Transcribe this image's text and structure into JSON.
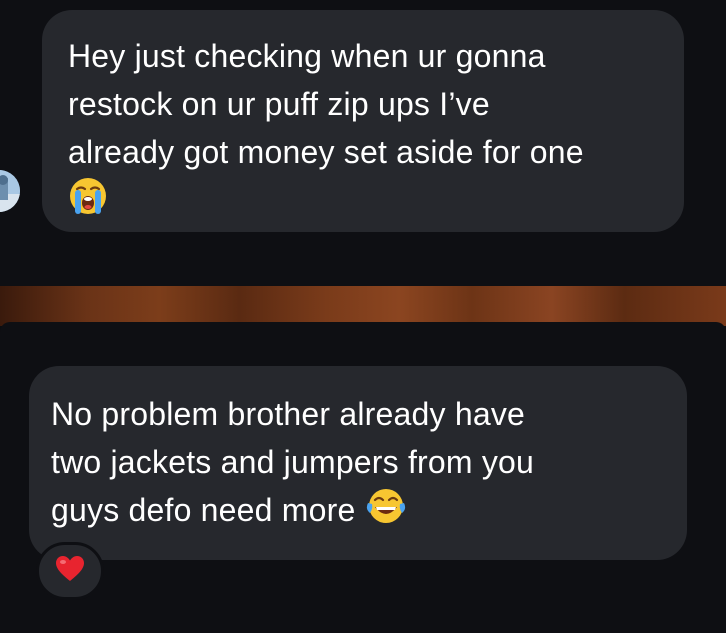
{
  "messages": [
    {
      "lines": [
        "Hey just checking when ur gonna",
        "restock on ur puff zip ups I’ve",
        "already got money set aside for one"
      ],
      "emoji": "loudly-crying-face"
    },
    {
      "lines": [
        "No problem brother already have",
        "two jackets and jumpers from you",
        "guys defo need more"
      ],
      "emoji": "face-with-tears-of-joy",
      "reaction": "red-heart"
    }
  ]
}
